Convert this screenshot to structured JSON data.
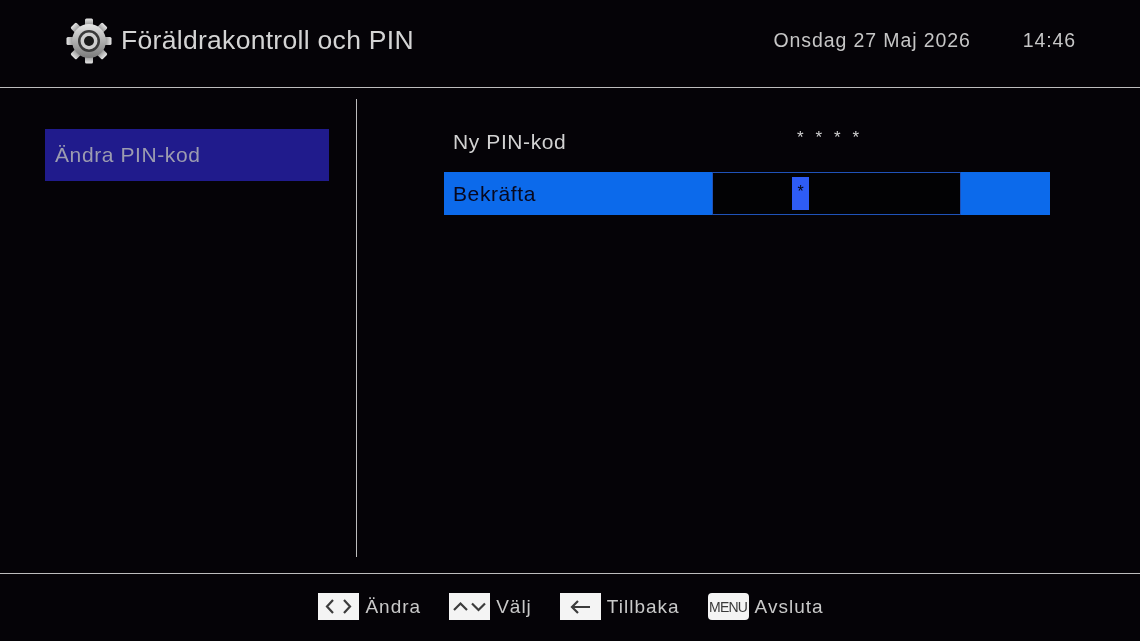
{
  "header": {
    "title": "Föräldrakontroll och PIN",
    "date": "Onsdag 27 Maj 2026",
    "time": "14:46"
  },
  "sidebar": {
    "items": [
      {
        "label": "Ändra PIN-kod",
        "selected": true
      }
    ]
  },
  "form": {
    "rows": [
      {
        "label": "Ny PIN-kod",
        "value": "* * * *",
        "selected": false
      },
      {
        "label": "Bekräfta",
        "value": "*",
        "selected": true
      }
    ]
  },
  "footer": {
    "hints": [
      {
        "kind": "left-right",
        "label": "Ändra"
      },
      {
        "kind": "up-down",
        "label": "Välj"
      },
      {
        "kind": "back",
        "label": "Tillbaka"
      },
      {
        "kind": "text-key",
        "key": "MENU",
        "label": "Avsluta"
      }
    ]
  }
}
